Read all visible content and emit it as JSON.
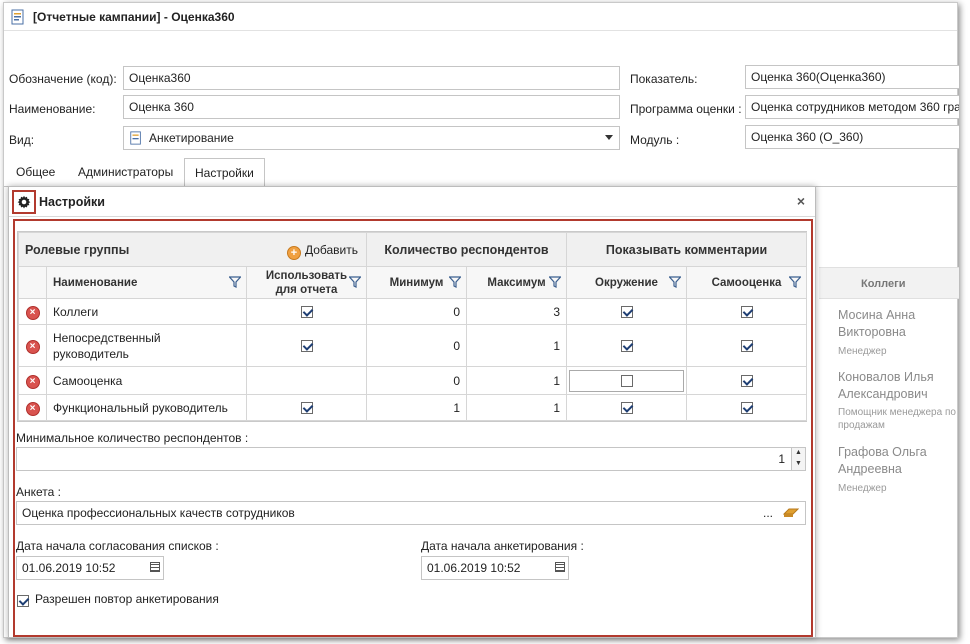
{
  "window": {
    "title": "[Отчетные кампании] - Оценка360"
  },
  "form": {
    "code_label": "Обозначение (код):",
    "code_value": "Оценка360",
    "name_label": "Наименование:",
    "name_value": "Оценка 360",
    "kind_label": "Вид:",
    "kind_value": "Анкетирование",
    "indicator_label": "Показатель:",
    "indicator_value": "Оценка 360(Оценка360)",
    "program_label": "Программа оценки :",
    "program_value": "Оценка сотрудников методом 360 гра",
    "module_label": "Модуль :",
    "module_value": "Оценка 360 (О_360)"
  },
  "tabs": [
    {
      "label": "Общее"
    },
    {
      "label": "Администраторы"
    },
    {
      "label": "Настройки"
    }
  ],
  "background": {
    "column_title": "Коллеги",
    "people": [
      {
        "name1": "Мосина Анна",
        "name2": "Викторовна",
        "role1": "Менеджер",
        "role2": ""
      },
      {
        "name1": "Коновалов Илья",
        "name2": "Александрович",
        "role1": "Помощник менеджера по",
        "role2": "продажам"
      },
      {
        "name1": "Графова Ольга",
        "name2": "Андреевна",
        "role1": "Менеджер",
        "role2": ""
      }
    ]
  },
  "modal": {
    "title": "Настройки",
    "close": "×",
    "grid": {
      "group_roles": "Ролевые группы",
      "add_label": "Добавить",
      "group_count": "Количество респондентов",
      "group_comments": "Показывать комментарии",
      "col_name": "Наименование",
      "col_use_1": "Использовать",
      "col_use_2": "для отчета",
      "col_min": "Минимум",
      "col_max": "Максимум",
      "col_env": "Окружение",
      "col_self": "Самооценка",
      "rows": [
        {
          "name1": "Коллеги",
          "name2": "",
          "use": true,
          "min": "0",
          "max": "3",
          "env": true,
          "self": true
        },
        {
          "name1": "Непосредственный",
          "name2": "руководитель",
          "use": true,
          "min": "0",
          "max": "1",
          "env": true,
          "self": true
        },
        {
          "name1": "Самооценка",
          "name2": "",
          "use": false,
          "min": "0",
          "max": "1",
          "env": false,
          "self": true
        },
        {
          "name1": "Функциональный руководитель",
          "name2": "",
          "use": true,
          "min": "1",
          "max": "1",
          "env": true,
          "self": true
        }
      ]
    },
    "min_resp_label": "Минимальное количество респондентов :",
    "min_resp_value": "1",
    "survey_label": "Анкета :",
    "survey_value": "Оценка профессиональных качеств сотрудников",
    "survey_dots": "...",
    "date_lists_label": "Дата начала согласования списков :",
    "date_lists_value": "01.06.2019 10:52",
    "date_survey_label": "Дата начала анкетирования :",
    "date_survey_value": "01.06.2019 10:52",
    "repeat_label": "Разрешен повтор анкетирования",
    "repeat_checked": true
  }
}
